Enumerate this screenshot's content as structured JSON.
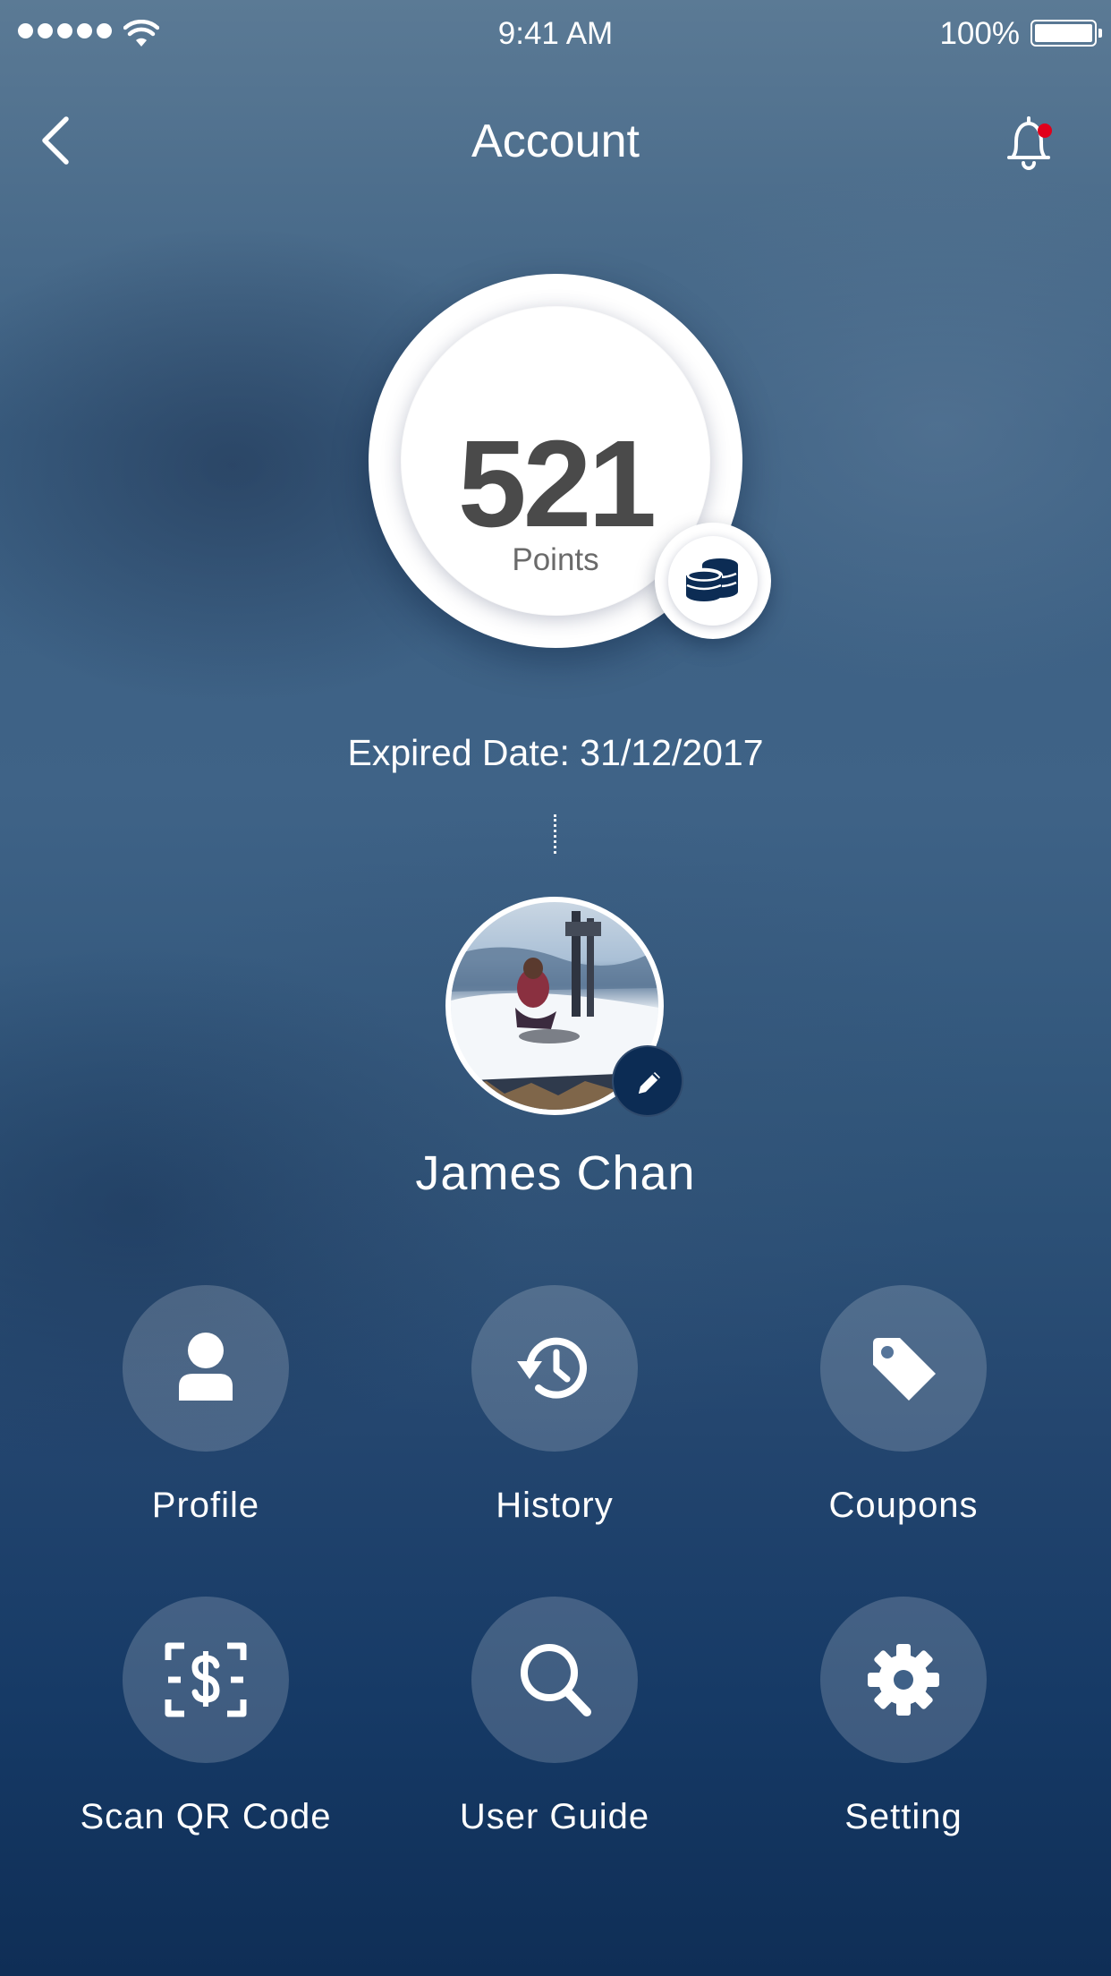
{
  "status_bar": {
    "time": "9:41 AM",
    "battery": "100%",
    "icons": [
      "signal-dots-icon",
      "wifi-icon",
      "battery-icon"
    ]
  },
  "nav": {
    "title": "Account",
    "back_icon": "chevron-left-icon",
    "notification_icon": "bell-icon",
    "notification_dot_color": "#e0001b"
  },
  "points": {
    "value": "521",
    "label": "Points",
    "badge_icon": "coins-stack-icon"
  },
  "expired_date": "Expired Date: 31/12/2017",
  "user": {
    "name": "James Chan",
    "edit_icon": "pencil-icon"
  },
  "menu": [
    {
      "label": "Profile",
      "icon": "user-icon"
    },
    {
      "label": "History",
      "icon": "history-icon"
    },
    {
      "label": "Coupons",
      "icon": "tag-icon"
    },
    {
      "label": "Scan QR Code",
      "icon": "scan-dollar-icon"
    },
    {
      "label": "User Guide",
      "icon": "search-icon"
    },
    {
      "label": "Setting",
      "icon": "gear-icon"
    }
  ],
  "colors": {
    "accent_dark": "#0c2c54",
    "points_text": "#4a4a4a"
  }
}
